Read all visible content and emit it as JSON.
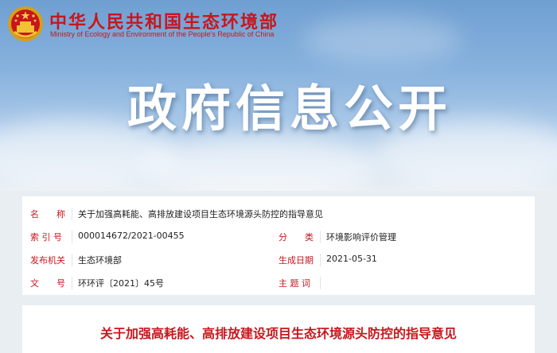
{
  "header": {
    "site_title": "中华人民共和国生态环境部",
    "site_subtitle": "Ministry of Ecology and Environment of the People's Republic of China",
    "emblem_icon": "national-emblem-icon",
    "banner_title": "政府信息公开"
  },
  "colors": {
    "brand_red": "#c8161d",
    "sky_blue": "#86b1dd"
  },
  "meta": {
    "name_label": "名　　称",
    "name_value": "关于加强高耗能、高排放建设项目生态环境源头防控的指导意见",
    "index_label": "索 引 号",
    "index_value": "000014672/2021-00455",
    "category_label": "分　　类",
    "category_value": "环境影响评价管理",
    "issuer_label": "发布机关",
    "issuer_value": "生态环境部",
    "date_label": "生成日期",
    "date_value": "2021-05-31",
    "docno_label": "文　　号",
    "docno_value": "环环评〔2021〕45号",
    "keywords_label": "主 题 词",
    "keywords_value": ""
  },
  "document": {
    "title": "关于加强高耗能、高排放建设项目生态环境源头防控的指导意见"
  }
}
